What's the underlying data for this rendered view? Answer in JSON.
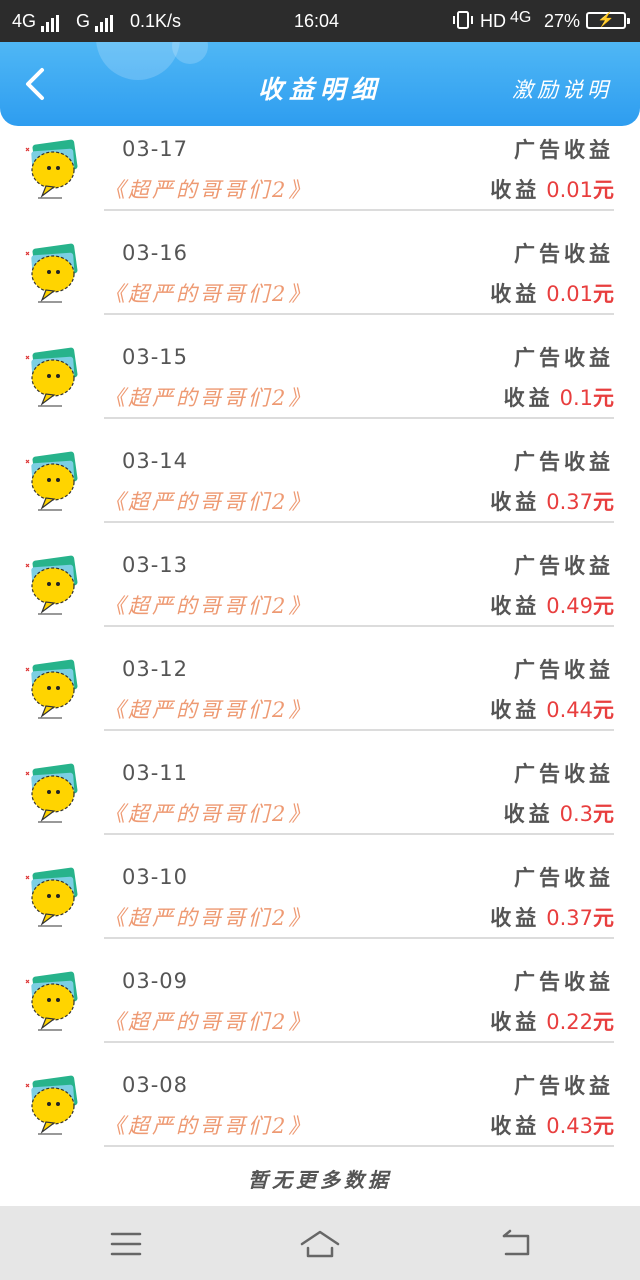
{
  "status_bar": {
    "network_left": "4G",
    "network_g": "G",
    "speed": "0.1K/s",
    "time": "16:04",
    "hd": "HD",
    "network_right": "4G",
    "battery": "27%"
  },
  "header": {
    "title": "收益明细",
    "action": "激励说明",
    "back_icon": "chevron-left-icon"
  },
  "records": [
    {
      "date": "03-17",
      "show": "《超严的哥哥们2》",
      "type": "广告收益",
      "earn_label": "收益",
      "amount": "0.01",
      "unit": "元"
    },
    {
      "date": "03-16",
      "show": "《超严的哥哥们2》",
      "type": "广告收益",
      "earn_label": "收益",
      "amount": "0.01",
      "unit": "元"
    },
    {
      "date": "03-15",
      "show": "《超严的哥哥们2》",
      "type": "广告收益",
      "earn_label": "收益",
      "amount": "0.1",
      "unit": "元"
    },
    {
      "date": "03-14",
      "show": "《超严的哥哥们2》",
      "type": "广告收益",
      "earn_label": "收益",
      "amount": "0.37",
      "unit": "元"
    },
    {
      "date": "03-13",
      "show": "《超严的哥哥们2》",
      "type": "广告收益",
      "earn_label": "收益",
      "amount": "0.49",
      "unit": "元"
    },
    {
      "date": "03-12",
      "show": "《超严的哥哥们2》",
      "type": "广告收益",
      "earn_label": "收益",
      "amount": "0.44",
      "unit": "元"
    },
    {
      "date": "03-11",
      "show": "《超严的哥哥们2》",
      "type": "广告收益",
      "earn_label": "收益",
      "amount": "0.3",
      "unit": "元"
    },
    {
      "date": "03-10",
      "show": "《超严的哥哥们2》",
      "type": "广告收益",
      "earn_label": "收益",
      "amount": "0.37",
      "unit": "元"
    },
    {
      "date": "03-09",
      "show": "《超严的哥哥们2》",
      "type": "广告收益",
      "earn_label": "收益",
      "amount": "0.22",
      "unit": "元"
    },
    {
      "date": "03-08",
      "show": "《超严的哥哥们2》",
      "type": "广告收益",
      "earn_label": "收益",
      "amount": "0.43",
      "unit": "元"
    }
  ],
  "footer_text": "暂无更多数据",
  "navbar": {
    "menu_icon": "menu-icon",
    "home_icon": "home-icon",
    "back_icon": "back-icon"
  },
  "colors": {
    "header_blue": "#2e9df0",
    "show_orange": "#ee9a73",
    "amount_red": "#e83e3e",
    "divider": "#dcdcdc"
  }
}
